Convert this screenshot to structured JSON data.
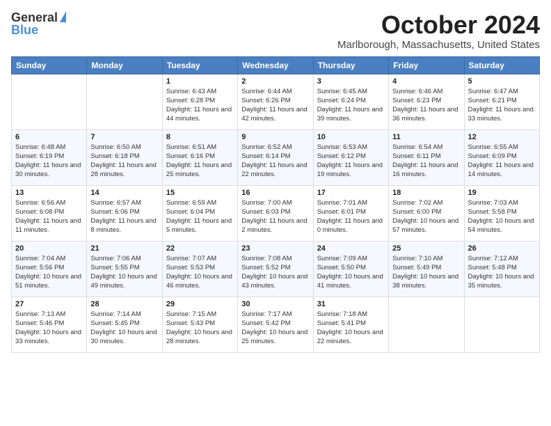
{
  "logo": {
    "general": "General",
    "blue": "Blue"
  },
  "header": {
    "month": "October 2024",
    "location": "Marlborough, Massachusetts, United States"
  },
  "weekdays": [
    "Sunday",
    "Monday",
    "Tuesday",
    "Wednesday",
    "Thursday",
    "Friday",
    "Saturday"
  ],
  "weeks": [
    [
      {
        "day": "",
        "info": ""
      },
      {
        "day": "",
        "info": ""
      },
      {
        "day": "1",
        "info": "Sunrise: 6:43 AM\nSunset: 6:28 PM\nDaylight: 11 hours and 44 minutes."
      },
      {
        "day": "2",
        "info": "Sunrise: 6:44 AM\nSunset: 6:26 PM\nDaylight: 11 hours and 42 minutes."
      },
      {
        "day": "3",
        "info": "Sunrise: 6:45 AM\nSunset: 6:24 PM\nDaylight: 11 hours and 39 minutes."
      },
      {
        "day": "4",
        "info": "Sunrise: 6:46 AM\nSunset: 6:23 PM\nDaylight: 11 hours and 36 minutes."
      },
      {
        "day": "5",
        "info": "Sunrise: 6:47 AM\nSunset: 6:21 PM\nDaylight: 11 hours and 33 minutes."
      }
    ],
    [
      {
        "day": "6",
        "info": "Sunrise: 6:48 AM\nSunset: 6:19 PM\nDaylight: 11 hours and 30 minutes."
      },
      {
        "day": "7",
        "info": "Sunrise: 6:50 AM\nSunset: 6:18 PM\nDaylight: 11 hours and 28 minutes."
      },
      {
        "day": "8",
        "info": "Sunrise: 6:51 AM\nSunset: 6:16 PM\nDaylight: 11 hours and 25 minutes."
      },
      {
        "day": "9",
        "info": "Sunrise: 6:52 AM\nSunset: 6:14 PM\nDaylight: 11 hours and 22 minutes."
      },
      {
        "day": "10",
        "info": "Sunrise: 6:53 AM\nSunset: 6:12 PM\nDaylight: 11 hours and 19 minutes."
      },
      {
        "day": "11",
        "info": "Sunrise: 6:54 AM\nSunset: 6:11 PM\nDaylight: 11 hours and 16 minutes."
      },
      {
        "day": "12",
        "info": "Sunrise: 6:55 AM\nSunset: 6:09 PM\nDaylight: 11 hours and 14 minutes."
      }
    ],
    [
      {
        "day": "13",
        "info": "Sunrise: 6:56 AM\nSunset: 6:08 PM\nDaylight: 11 hours and 11 minutes."
      },
      {
        "day": "14",
        "info": "Sunrise: 6:57 AM\nSunset: 6:06 PM\nDaylight: 11 hours and 8 minutes."
      },
      {
        "day": "15",
        "info": "Sunrise: 6:59 AM\nSunset: 6:04 PM\nDaylight: 11 hours and 5 minutes."
      },
      {
        "day": "16",
        "info": "Sunrise: 7:00 AM\nSunset: 6:03 PM\nDaylight: 11 hours and 2 minutes."
      },
      {
        "day": "17",
        "info": "Sunrise: 7:01 AM\nSunset: 6:01 PM\nDaylight: 11 hours and 0 minutes."
      },
      {
        "day": "18",
        "info": "Sunrise: 7:02 AM\nSunset: 6:00 PM\nDaylight: 10 hours and 57 minutes."
      },
      {
        "day": "19",
        "info": "Sunrise: 7:03 AM\nSunset: 5:58 PM\nDaylight: 10 hours and 54 minutes."
      }
    ],
    [
      {
        "day": "20",
        "info": "Sunrise: 7:04 AM\nSunset: 5:56 PM\nDaylight: 10 hours and 51 minutes."
      },
      {
        "day": "21",
        "info": "Sunrise: 7:06 AM\nSunset: 5:55 PM\nDaylight: 10 hours and 49 minutes."
      },
      {
        "day": "22",
        "info": "Sunrise: 7:07 AM\nSunset: 5:53 PM\nDaylight: 10 hours and 46 minutes."
      },
      {
        "day": "23",
        "info": "Sunrise: 7:08 AM\nSunset: 5:52 PM\nDaylight: 10 hours and 43 minutes."
      },
      {
        "day": "24",
        "info": "Sunrise: 7:09 AM\nSunset: 5:50 PM\nDaylight: 10 hours and 41 minutes."
      },
      {
        "day": "25",
        "info": "Sunrise: 7:10 AM\nSunset: 5:49 PM\nDaylight: 10 hours and 38 minutes."
      },
      {
        "day": "26",
        "info": "Sunrise: 7:12 AM\nSunset: 5:48 PM\nDaylight: 10 hours and 35 minutes."
      }
    ],
    [
      {
        "day": "27",
        "info": "Sunrise: 7:13 AM\nSunset: 5:46 PM\nDaylight: 10 hours and 33 minutes."
      },
      {
        "day": "28",
        "info": "Sunrise: 7:14 AM\nSunset: 5:45 PM\nDaylight: 10 hours and 30 minutes."
      },
      {
        "day": "29",
        "info": "Sunrise: 7:15 AM\nSunset: 5:43 PM\nDaylight: 10 hours and 28 minutes."
      },
      {
        "day": "30",
        "info": "Sunrise: 7:17 AM\nSunset: 5:42 PM\nDaylight: 10 hours and 25 minutes."
      },
      {
        "day": "31",
        "info": "Sunrise: 7:18 AM\nSunset: 5:41 PM\nDaylight: 10 hours and 22 minutes."
      },
      {
        "day": "",
        "info": ""
      },
      {
        "day": "",
        "info": ""
      }
    ]
  ]
}
